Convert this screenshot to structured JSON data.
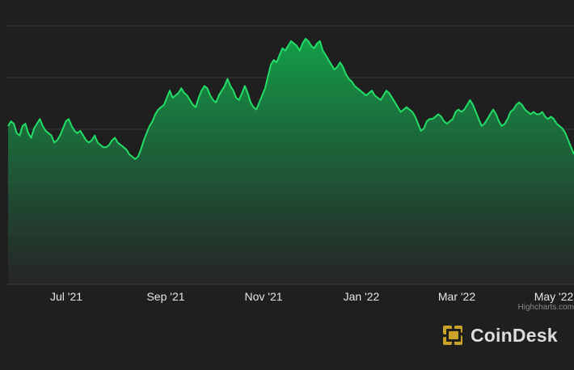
{
  "chart_data": {
    "type": "area",
    "title": "",
    "xlabel": "",
    "ylabel": "",
    "x_ticks": [
      "Jul '21",
      "Sep '21",
      "Nov '21",
      "Jan '22",
      "Mar '22",
      "May '22"
    ],
    "grid": true,
    "ylim": [
      0,
      10
    ],
    "color": "#22dd66",
    "series": [
      {
        "values": [
          6.3,
          6.5,
          6.4,
          6.0,
          5.9,
          6.3,
          6.4,
          6.0,
          5.8,
          6.2,
          6.4,
          6.6,
          6.3,
          6.1,
          6.0,
          5.9,
          5.6,
          5.7,
          5.9,
          6.2,
          6.5,
          6.6,
          6.3,
          6.1,
          6.0,
          6.1,
          5.9,
          5.7,
          5.6,
          5.7,
          5.9,
          5.6,
          5.5,
          5.4,
          5.4,
          5.5,
          5.7,
          5.8,
          5.6,
          5.5,
          5.4,
          5.3,
          5.1,
          5.0,
          4.9,
          5.0,
          5.3,
          5.7,
          6.0,
          6.3,
          6.5,
          6.8,
          7.0,
          7.1,
          7.2,
          7.5,
          7.8,
          7.5,
          7.6,
          7.7,
          7.9,
          7.7,
          7.6,
          7.4,
          7.2,
          7.1,
          7.5,
          7.8,
          8.0,
          7.9,
          7.6,
          7.4,
          7.3,
          7.6,
          7.8,
          8.0,
          8.3,
          8.0,
          7.8,
          7.5,
          7.4,
          7.7,
          8.0,
          7.7,
          7.3,
          7.1,
          7.0,
          7.3,
          7.6,
          7.9,
          8.4,
          8.9,
          9.1,
          9.0,
          9.3,
          9.6,
          9.5,
          9.7,
          9.9,
          9.8,
          9.7,
          9.5,
          9.8,
          10.0,
          9.9,
          9.7,
          9.6,
          9.8,
          9.9,
          9.5,
          9.3,
          9.1,
          8.9,
          8.7,
          8.8,
          9.0,
          8.8,
          8.5,
          8.3,
          8.2,
          8.0,
          7.9,
          7.8,
          7.7,
          7.6,
          7.7,
          7.8,
          7.6,
          7.5,
          7.4,
          7.6,
          7.8,
          7.7,
          7.5,
          7.3,
          7.1,
          6.9,
          7.0,
          7.1,
          7.0,
          6.9,
          6.7,
          6.4,
          6.1,
          6.2,
          6.5,
          6.6,
          6.6,
          6.7,
          6.8,
          6.7,
          6.5,
          6.4,
          6.5,
          6.6,
          6.9,
          7.0,
          6.9,
          7.0,
          7.2,
          7.4,
          7.2,
          6.9,
          6.6,
          6.3,
          6.4,
          6.6,
          6.8,
          7.0,
          6.8,
          6.5,
          6.3,
          6.4,
          6.6,
          6.9,
          7.0,
          7.2,
          7.3,
          7.2,
          7.0,
          6.9,
          6.8,
          6.9,
          6.8,
          6.8,
          6.9,
          6.7,
          6.6,
          6.7,
          6.6,
          6.4,
          6.3,
          6.2,
          6.0,
          5.7,
          5.4,
          5.1
        ]
      }
    ]
  },
  "credits": "Highcharts.com",
  "brand": {
    "name": "CoinDesk"
  }
}
